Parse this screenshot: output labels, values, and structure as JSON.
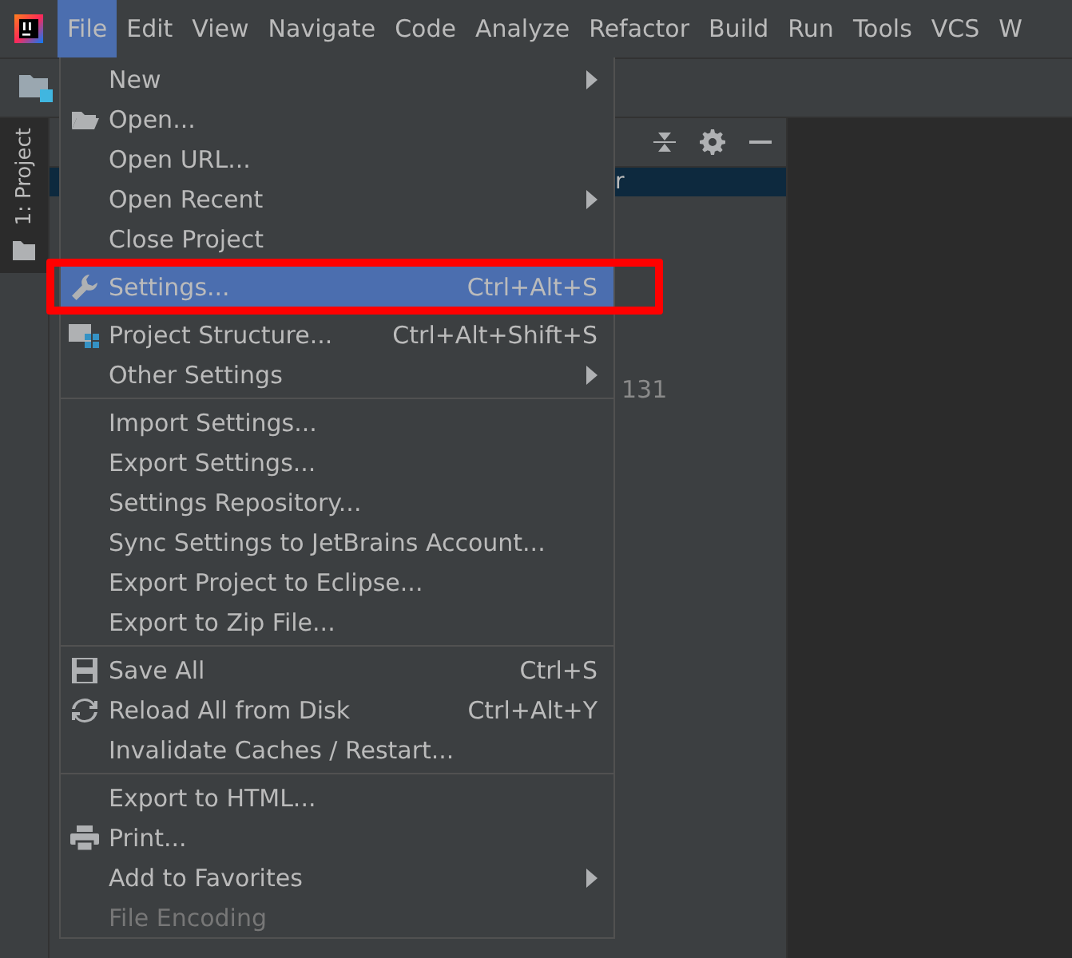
{
  "menu_bar": [
    {
      "label": "File",
      "selected": true
    },
    {
      "label": "Edit",
      "selected": false
    },
    {
      "label": "View",
      "selected": false
    },
    {
      "label": "Navigate",
      "selected": false
    },
    {
      "label": "Code",
      "selected": false
    },
    {
      "label": "Analyze",
      "selected": false
    },
    {
      "label": "Refactor",
      "selected": false
    },
    {
      "label": "Build",
      "selected": false
    },
    {
      "label": "Run",
      "selected": false
    },
    {
      "label": "Tools",
      "selected": false
    },
    {
      "label": "VCS",
      "selected": false
    },
    {
      "label": "W",
      "selected": false
    }
  ],
  "tool_stripe": {
    "label": "1: Project"
  },
  "project_panel": {
    "selected_row_text": "r",
    "row_text": "131"
  },
  "file_menu": [
    {
      "kind": "plain",
      "label": "New",
      "submenu": true,
      "selected": false,
      "disabled": false
    },
    {
      "kind": "folder",
      "label": "Open...",
      "selected": false,
      "disabled": false
    },
    {
      "kind": "plain",
      "label": "Open URL...",
      "selected": false,
      "disabled": false
    },
    {
      "kind": "plain",
      "label": "Open Recent",
      "submenu": true,
      "selected": false,
      "disabled": false
    },
    {
      "kind": "plain",
      "label": "Close Project",
      "selected": false,
      "disabled": false
    },
    {
      "kind": "wrench",
      "label": "Settings...",
      "shortcut": "Ctrl+Alt+S",
      "selected": true,
      "disabled": false,
      "annotated": true
    },
    {
      "kind": "structure",
      "label": "Project Structure...",
      "shortcut": "Ctrl+Alt+Shift+S",
      "selected": false,
      "disabled": false
    },
    {
      "kind": "plain",
      "label": "Other Settings",
      "submenu": true,
      "selected": false,
      "disabled": false
    },
    {
      "kind": "separator"
    },
    {
      "kind": "plain",
      "label": "Import Settings...",
      "selected": false,
      "disabled": false
    },
    {
      "kind": "plain",
      "label": "Export Settings...",
      "selected": false,
      "disabled": false
    },
    {
      "kind": "plain",
      "label": "Settings Repository...",
      "selected": false,
      "disabled": false
    },
    {
      "kind": "plain",
      "label": "Sync Settings to JetBrains Account...",
      "selected": false,
      "disabled": false
    },
    {
      "kind": "plain",
      "label": "Export Project to Eclipse...",
      "selected": false,
      "disabled": false
    },
    {
      "kind": "plain",
      "label": "Export to Zip File...",
      "selected": false,
      "disabled": false
    },
    {
      "kind": "separator"
    },
    {
      "kind": "save",
      "label": "Save All",
      "shortcut": "Ctrl+S",
      "selected": false,
      "disabled": false
    },
    {
      "kind": "reload",
      "label": "Reload All from Disk",
      "shortcut": "Ctrl+Alt+Y",
      "selected": false,
      "disabled": false
    },
    {
      "kind": "plain",
      "label": "Invalidate Caches / Restart...",
      "selected": false,
      "disabled": false
    },
    {
      "kind": "separator"
    },
    {
      "kind": "plain",
      "label": "Export to HTML...",
      "selected": false,
      "disabled": false
    },
    {
      "kind": "printer",
      "label": "Print...",
      "selected": false,
      "disabled": false
    },
    {
      "kind": "plain",
      "label": "Add to Favorites",
      "submenu": true,
      "selected": false,
      "disabled": false
    },
    {
      "kind": "plain",
      "label": "File Encoding",
      "selected": false,
      "disabled": true
    }
  ]
}
